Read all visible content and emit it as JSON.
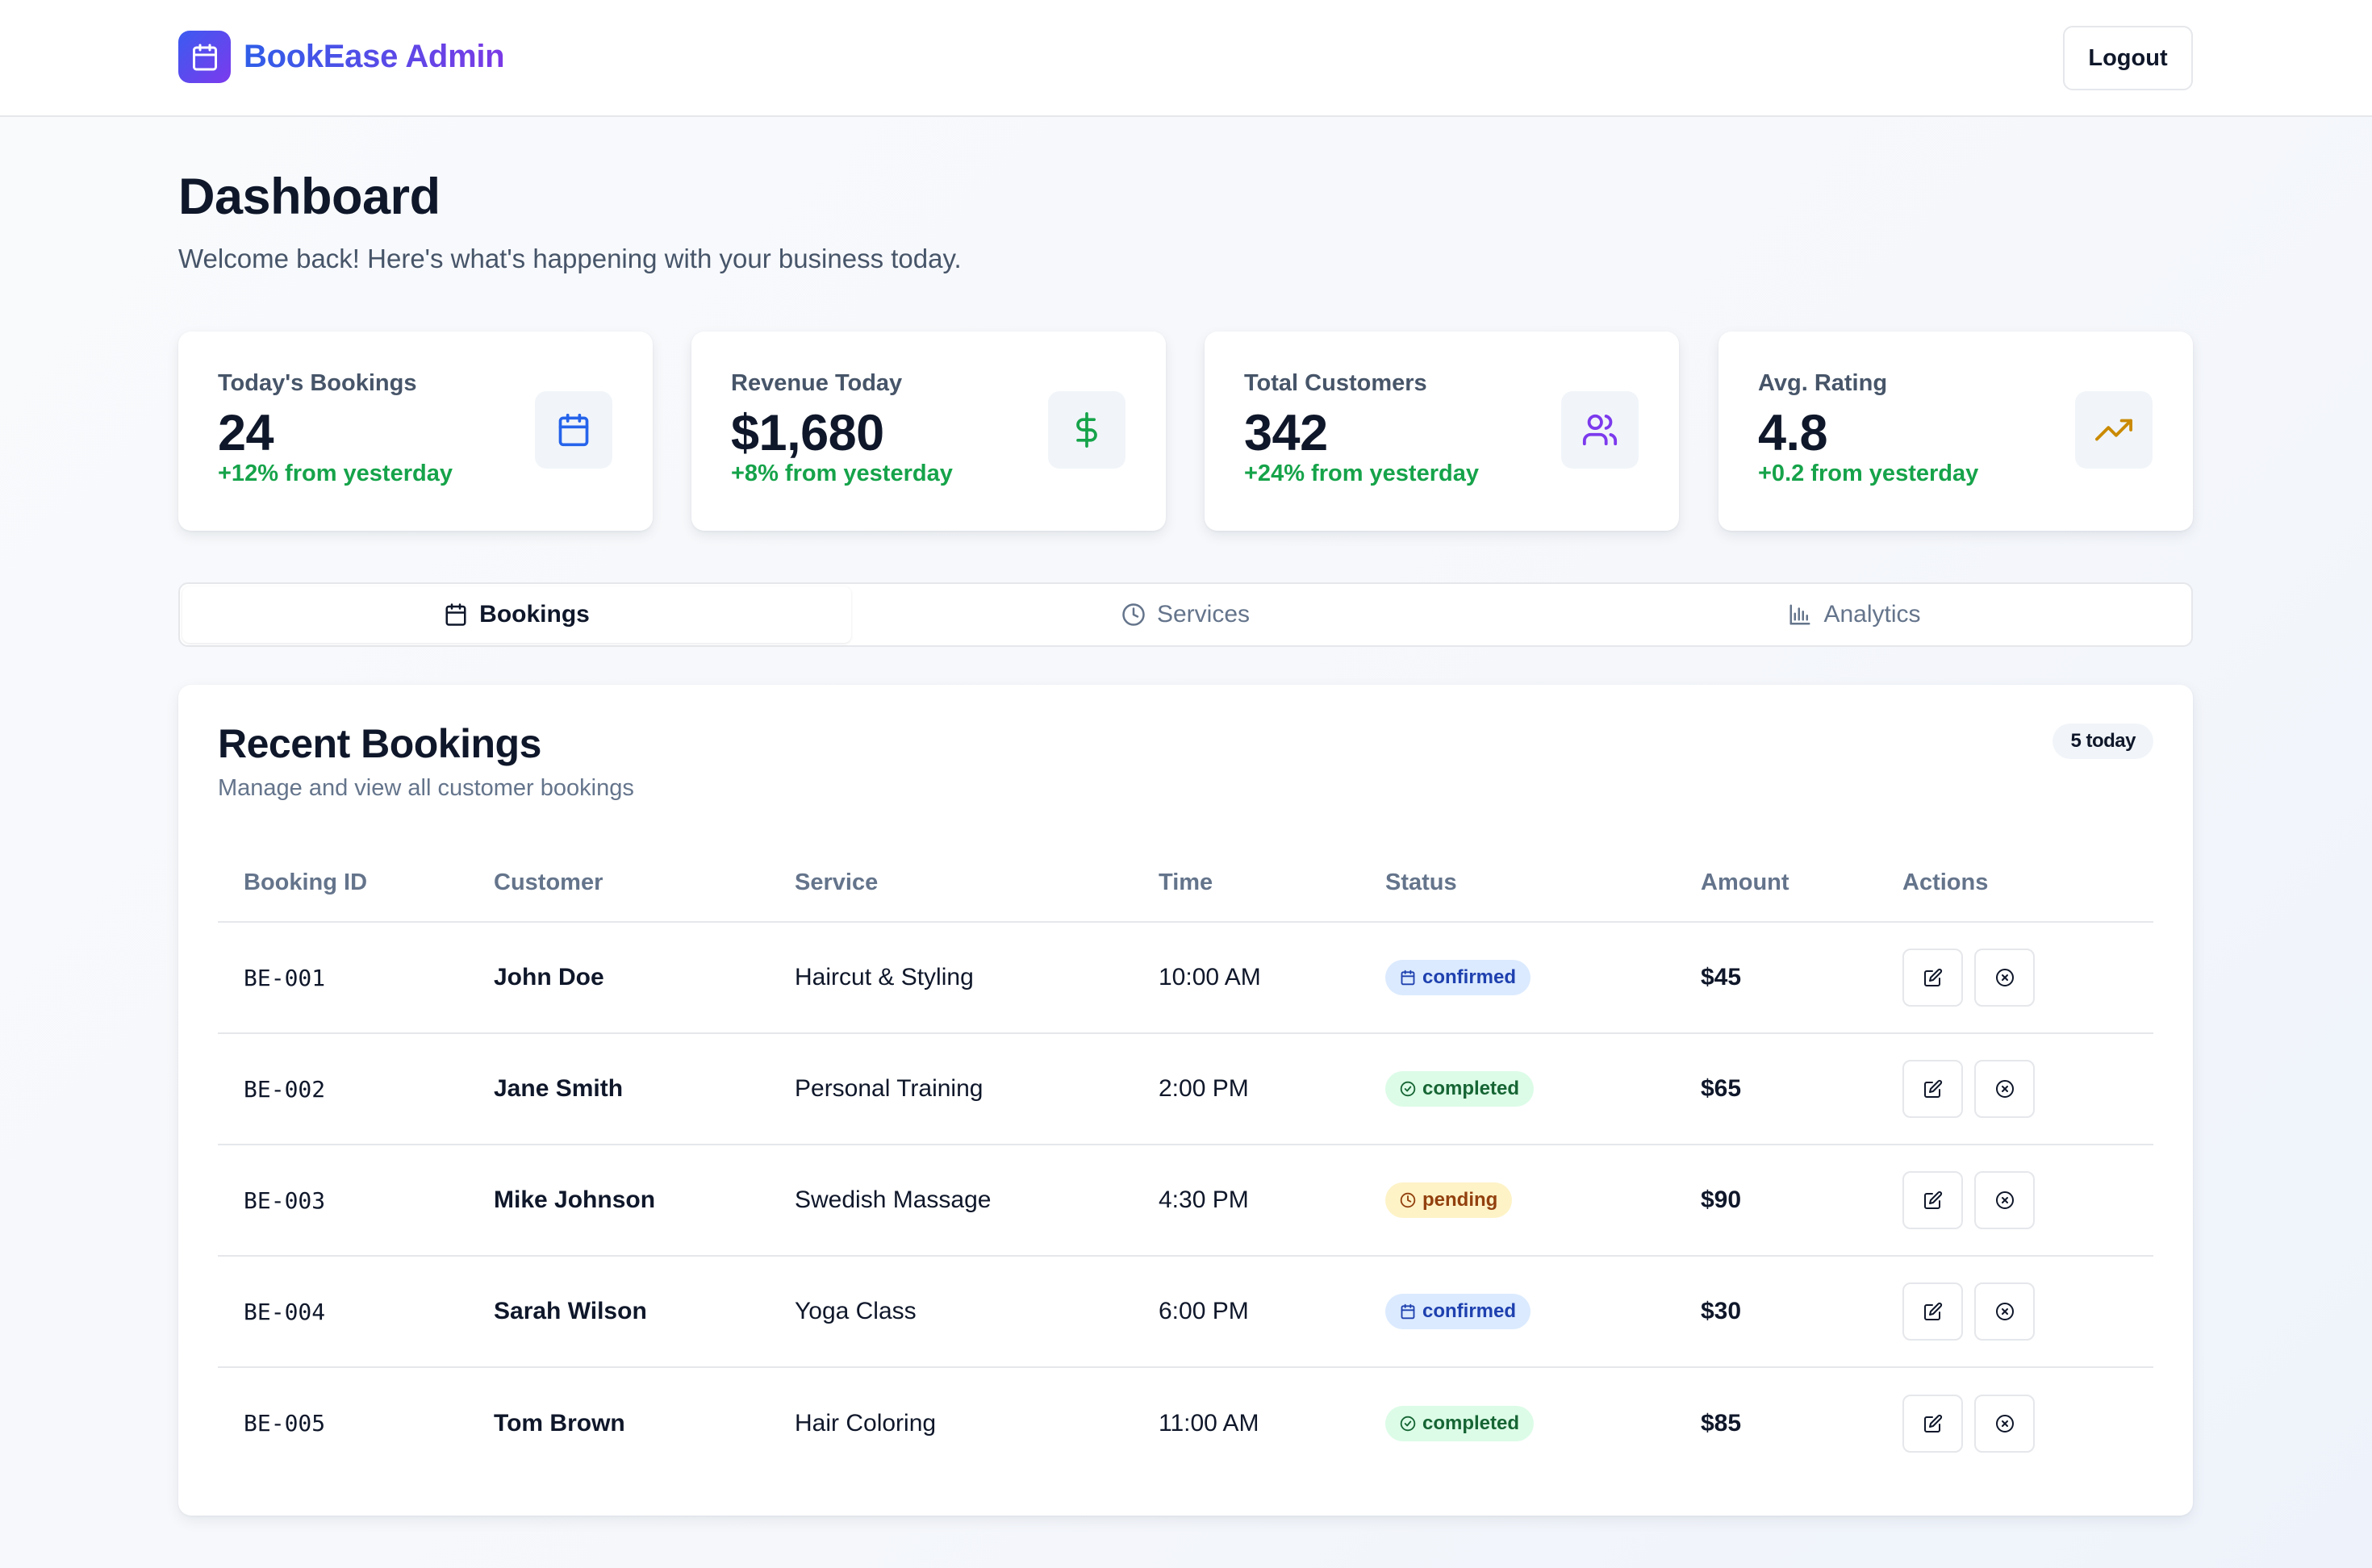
{
  "header": {
    "app_name": "BookEase Admin",
    "logo_icon": "calendar-icon",
    "logout_label": "Logout"
  },
  "page": {
    "title": "Dashboard",
    "subtitle": "Welcome back! Here's what's happening with your business today."
  },
  "stats": [
    {
      "label": "Today's Bookings",
      "value": "24",
      "change": "+12% from yesterday",
      "icon": "calendar-icon",
      "icon_color": "#2563eb"
    },
    {
      "label": "Revenue Today",
      "value": "$1,680",
      "change": "+8% from yesterday",
      "icon": "dollar-icon",
      "icon_color": "#16a34a"
    },
    {
      "label": "Total Customers",
      "value": "342",
      "change": "+24% from yesterday",
      "icon": "users-icon",
      "icon_color": "#7c3aed"
    },
    {
      "label": "Avg. Rating",
      "value": "4.8",
      "change": "+0.2 from yesterday",
      "icon": "trending-up-icon",
      "icon_color": "#ca8a04"
    }
  ],
  "tabs": [
    {
      "label": "Bookings",
      "icon": "calendar-icon",
      "active": true
    },
    {
      "label": "Services",
      "icon": "clock-icon",
      "active": false
    },
    {
      "label": "Analytics",
      "icon": "bar-chart-icon",
      "active": false
    }
  ],
  "bookings": {
    "title": "Recent Bookings",
    "subtitle": "Manage and view all customer bookings",
    "count_badge": "5 today",
    "columns": [
      "Booking ID",
      "Customer",
      "Service",
      "Time",
      "Status",
      "Amount",
      "Actions"
    ],
    "rows": [
      {
        "id": "BE-001",
        "customer": "John Doe",
        "service": "Haircut & Styling",
        "time": "10:00 AM",
        "status": "confirmed",
        "amount": "$45"
      },
      {
        "id": "BE-002",
        "customer": "Jane Smith",
        "service": "Personal Training",
        "time": "2:00 PM",
        "status": "completed",
        "amount": "$65"
      },
      {
        "id": "BE-003",
        "customer": "Mike Johnson",
        "service": "Swedish Massage",
        "time": "4:30 PM",
        "status": "pending",
        "amount": "$90"
      },
      {
        "id": "BE-004",
        "customer": "Sarah Wilson",
        "service": "Yoga Class",
        "time": "6:00 PM",
        "status": "confirmed",
        "amount": "$30"
      },
      {
        "id": "BE-005",
        "customer": "Tom Brown",
        "service": "Hair Coloring",
        "time": "11:00 AM",
        "status": "completed",
        "amount": "$85"
      }
    ]
  },
  "colors": {
    "accent_blue": "#2563eb",
    "accent_purple": "#7c3aed",
    "success_green": "#16a34a"
  }
}
